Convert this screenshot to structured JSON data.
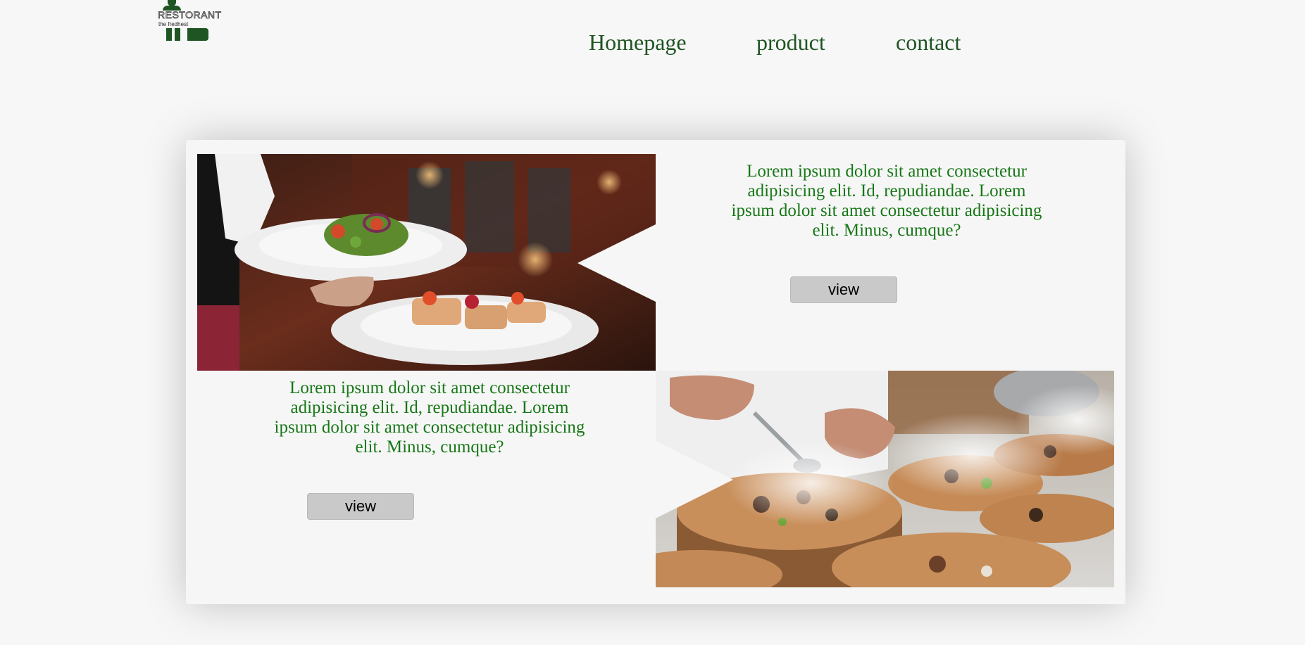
{
  "brand": {
    "logo_word": "RESTORANT",
    "logo_tagline": "the fredhest"
  },
  "nav": {
    "items": [
      {
        "label": "Homepage"
      },
      {
        "label": "product"
      },
      {
        "label": "contact"
      }
    ]
  },
  "sections": [
    {
      "image_desc": "waiter-carrying-salad-and-bruschetta",
      "text": "Lorem ipsum dolor sit amet consectetur adipisicing elit. Id, repudiandae. Lorem ipsum dolor sit amet consectetur adipisicing elit. Minus, cumque?",
      "button_label": "view"
    },
    {
      "image_desc": "chef-plating-dishes-on-wood-slices",
      "text": "Lorem ipsum dolor sit amet consectetur adipisicing elit. Id, repudiandae. Lorem ipsum dolor sit amet consectetur adipisicing elit. Minus, cumque?",
      "button_label": "view"
    }
  ],
  "colors": {
    "brand_green": "#1f5423",
    "text_green": "#177717",
    "button_gray": "#c9c9c9",
    "page_bg": "#f7f7f7"
  }
}
